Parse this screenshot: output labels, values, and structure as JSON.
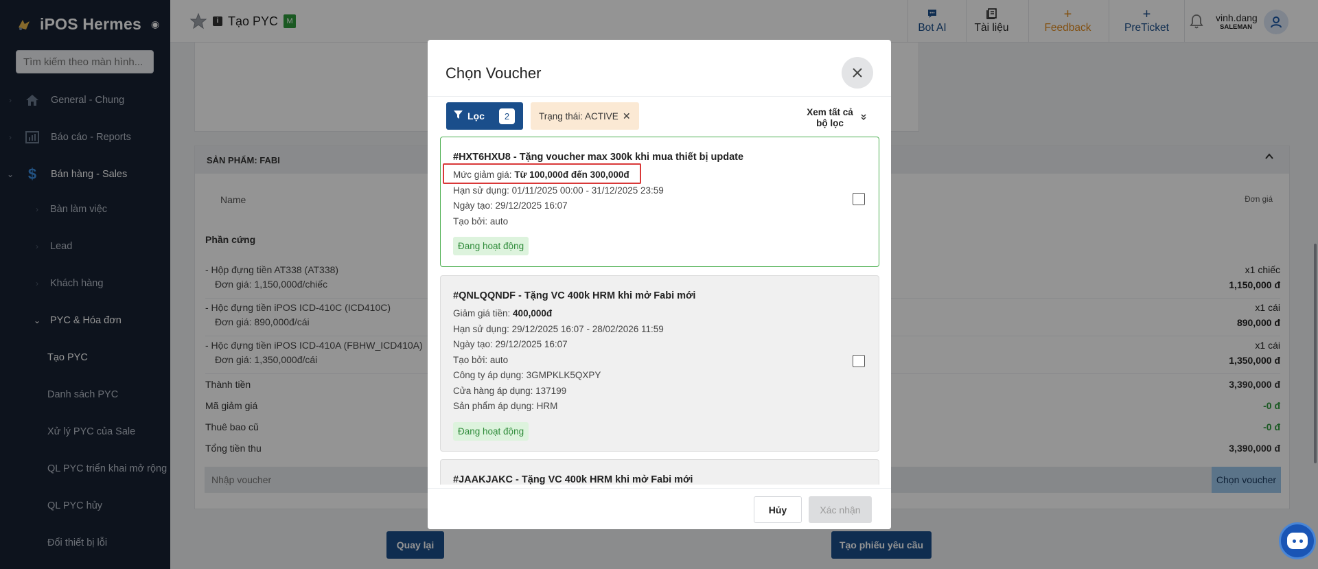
{
  "app": {
    "name": "iPOS Hermes",
    "status_dot": "◉"
  },
  "sidebar": {
    "search_placeholder": "Tìm kiếm theo màn hình...",
    "items": [
      {
        "label": "General - Chung",
        "icon": "home-icon"
      },
      {
        "label": "Báo cáo - Reports",
        "icon": "chart-icon"
      },
      {
        "label": "Bán hàng - Sales",
        "icon": "dollar-icon"
      },
      {
        "label": "Bàn làm việc"
      },
      {
        "label": "Lead"
      },
      {
        "label": "Khách hàng"
      },
      {
        "label": "PYC & Hóa đơn"
      },
      {
        "label": "Tạo PYC"
      },
      {
        "label": "Danh sách PYC"
      },
      {
        "label": "Xử lý PYC của Sale"
      },
      {
        "label": "QL PYC triển khai mở rộng"
      },
      {
        "label": "QL PYC hủy"
      },
      {
        "label": "Đổi thiết bị lỗi"
      }
    ]
  },
  "header": {
    "info_letter": "i",
    "page_title": "Tạo PYC",
    "page_badge": "M",
    "buttons": [
      {
        "icon": "chat-icon",
        "glyph": "💬",
        "label": "Bot AI",
        "color": "#1a4e8b"
      },
      {
        "icon": "book-icon",
        "glyph": "▤",
        "label": "Tài liệu",
        "color": "#222222"
      },
      {
        "icon": "plus-icon",
        "glyph": "+",
        "label": "Feedback",
        "color": "#e08a1e"
      },
      {
        "icon": "plus-icon",
        "glyph": "+",
        "label": "PreTicket",
        "color": "#1a4e8b"
      }
    ],
    "user": {
      "name": "vinh.dang",
      "role": "SALEMAN"
    }
  },
  "product_section": {
    "title": "SẢN PHẨM: FABI",
    "col_name": "Name",
    "col_price": "Đơn giá",
    "group": "Phần cứng",
    "rows": [
      {
        "name": "- Hộp đựng tiền AT338 (AT338)",
        "unit": "Đơn giá: 1,150,000đ/chiếc",
        "qty": "x1 chiếc",
        "total": "1,150,000 đ"
      },
      {
        "name": "- Hộc đựng tiền iPOS ICD-410C (ICD410C)",
        "unit": "Đơn giá: 890,000đ/cái",
        "qty": "x1 cái",
        "total": "890,000 đ"
      },
      {
        "name": "- Hộc đựng tiền iPOS ICD-410A (FBHW_ICD410A)",
        "unit": "Đơn giá: 1,350,000đ/cái",
        "qty": "x1 cái",
        "total": "1,350,000 đ"
      }
    ],
    "summary": [
      {
        "label": "Thành tiền",
        "value": "3,390,000 đ",
        "green": false
      },
      {
        "label": "Mã giảm giá",
        "value": "-0 đ",
        "green": true
      },
      {
        "label": "Thuê bao cũ",
        "value": "-0 đ",
        "green": true
      },
      {
        "label": "Tổng tiền thu",
        "value": "3,390,000 đ",
        "green": false
      }
    ],
    "voucher_placeholder": "Nhập voucher",
    "voucher_button": "Chọn voucher"
  },
  "footer": {
    "back": "Quay lại",
    "create": "Tạo phiếu yêu cầu"
  },
  "modal": {
    "title": "Chọn Voucher",
    "filter_label": "Lọc",
    "filter_count": "2",
    "chip_label": "Trạng thái: ACTIVE",
    "view_all": "Xem tất cả bộ lọc",
    "vouchers": [
      {
        "title": "#HXT6HXU8 - Tặng voucher max 300k khi mua thiết bị update",
        "lines": [
          {
            "label": "Mức giảm giá: ",
            "value": "Từ 100,000đ đến 300,000đ",
            "bold": true
          },
          {
            "label": "Hạn sử dụng: ",
            "value": "01/11/2025 00:00 - 31/12/2025 23:59",
            "bold": false
          },
          {
            "label": "Ngày tạo: ",
            "value": "29/12/2025 16:07",
            "bold": false
          },
          {
            "label": "Tạo bởi: ",
            "value": "auto",
            "bold": false
          }
        ],
        "status": "Đang hoạt động",
        "selected_style": true
      },
      {
        "title": "#QNLQQNDF - Tặng VC 400k HRM khi mở Fabi mới",
        "lines": [
          {
            "label": "Giảm giá tiền: ",
            "value": "400,000đ",
            "bold": true
          },
          {
            "label": "Hạn sử dụng: ",
            "value": "29/12/2025 16:07 - 28/02/2026 11:59",
            "bold": false
          },
          {
            "label": "Ngày tạo: ",
            "value": "29/12/2025 16:07",
            "bold": false
          },
          {
            "label": "Tạo bởi: ",
            "value": "auto",
            "bold": false
          },
          {
            "label": "Công ty áp dụng: ",
            "value": "3GMPKLK5QXPY",
            "bold": false
          },
          {
            "label": "Cửa hàng áp dụng: ",
            "value": "137199",
            "bold": false
          },
          {
            "label": "Sản phẩm áp dụng: ",
            "value": "HRM",
            "bold": false
          }
        ],
        "status": "Đang hoạt động",
        "selected_style": false
      },
      {
        "title": "#JAAKJAKC - Tặng VC 400k HRM khi mở Fabi mới",
        "lines": [],
        "status": "",
        "selected_style": false
      }
    ],
    "cancel": "Hủy",
    "confirm": "Xác nhận"
  },
  "colors": {
    "primary": "#1a4e8b",
    "sidebar_bg": "#182233",
    "active_green": "#2e8b39",
    "highlight_red": "#d93838",
    "chip_bg": "#fbe9d4"
  }
}
